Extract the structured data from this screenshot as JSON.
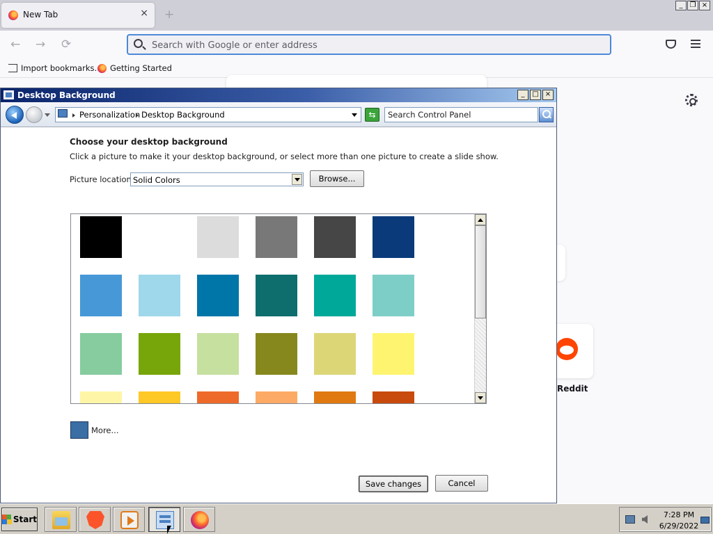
{
  "browser": {
    "tab_title": "New Tab",
    "tab_close": "×",
    "new_tab": "+",
    "address_placeholder": "Search with Google or enter address",
    "window_buttons": [
      "_",
      "❐",
      "×"
    ],
    "nav_back": "←",
    "nav_forward": "→",
    "nav_reload": "⟳",
    "bookmarks": [
      "Import bookmarks…",
      "Getting Started"
    ],
    "shortcut_label": "Reddit"
  },
  "dialog": {
    "title": "Desktop Background",
    "window_buttons": [
      "_",
      "□",
      "×"
    ],
    "breadcrumbs": [
      "Personalization",
      "Desktop Background"
    ],
    "search_placeholder": "Search Control Panel",
    "refresh_glyph": "⇆",
    "heading": "Choose your desktop background",
    "instructions": "Click a picture to make it your desktop background, or select more than one picture to create a slide show.",
    "picture_location_label": "Picture location:",
    "picture_location_value": "Solid Colors",
    "browse_label": "Browse...",
    "more_label": "More...",
    "more_color": "#3a6ea5",
    "save_label": "Save changes",
    "cancel_label": "Cancel",
    "swatch_rows": [
      [
        "#000000",
        "#ffffff",
        "#dcdcdc",
        "#787878",
        "#464646",
        "#0a3a7a"
      ],
      [
        "#4698d6",
        "#9ed8ea",
        "#0076a8",
        "#0e6e6e",
        "#00a89a",
        "#7ecec8"
      ],
      [
        "#86cc9e",
        "#76a60a",
        "#c6e0a0",
        "#86881e",
        "#dcd676",
        "#fef470"
      ],
      [
        "#fef6a6",
        "#fec826",
        "#ee6a2a",
        "#fcaa66",
        "#e07a10",
        "#c84a0c"
      ]
    ]
  },
  "taskbar": {
    "start_label": "Start",
    "apps": [
      {
        "name": "file-explorer"
      },
      {
        "name": "brave-browser"
      },
      {
        "name": "media-player"
      },
      {
        "name": "control-panel",
        "active": true
      },
      {
        "name": "firefox"
      }
    ],
    "clock_time": "7:28 PM",
    "clock_date": "6/29/2022"
  }
}
